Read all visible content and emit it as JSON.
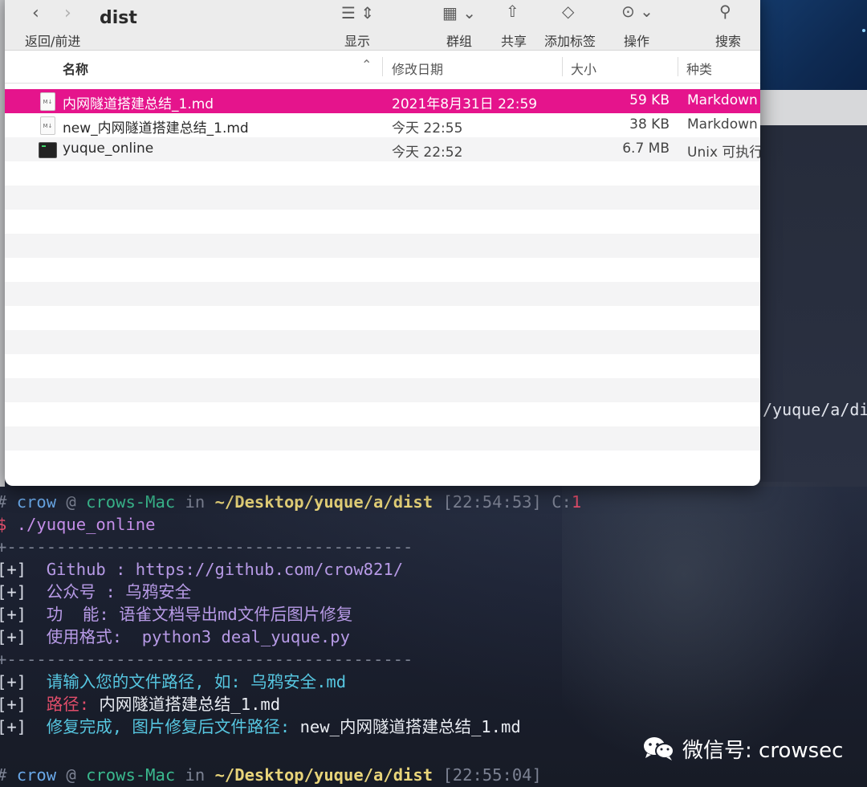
{
  "finder": {
    "title": "dist",
    "nav_label": "返回/前进",
    "toolbar": {
      "view_label": "显示",
      "group_label": "群组",
      "share_label": "共享",
      "tag_label": "添加标签",
      "action_label": "操作",
      "search_label": "搜索"
    },
    "columns": {
      "name": "名称",
      "date": "修改日期",
      "size": "大小",
      "kind": "种类"
    },
    "files": [
      {
        "name": "内网隧道搭建总结_1.md",
        "date": "2021年8月31日 22:59",
        "size": "59 KB",
        "kind": "Markdown",
        "icon": "markdown-file-icon"
      },
      {
        "name": "new_内网隧道搭建总结_1.md",
        "date": "今天 22:55",
        "size": "38 KB",
        "kind": "Markdown",
        "icon": "markdown-file-icon"
      },
      {
        "name": "yuque_online",
        "date": "今天 22:52",
        "size": "6.7 MB",
        "kind": "Unix 可执行",
        "icon": "executable-icon"
      }
    ],
    "selected_color": "#e5148c"
  },
  "side_text": "/yuque/a/di",
  "terminal": {
    "prompt1": {
      "hash": "#",
      "user": "crow",
      "at": "@",
      "host": "crows-Mac",
      "in": "in",
      "path": "~/Desktop/yuque/a/dist",
      "time": "[22:54:53]",
      "code_label": "C:",
      "code": "1"
    },
    "command": {
      "dollar": "$",
      "text": "./yuque_online"
    },
    "separator": "+-----------------------------------------",
    "info_lines": [
      {
        "tag": "[+]",
        "text": "Github : https://github.com/crow821/"
      },
      {
        "tag": "[+]",
        "text": "公众号 : 乌鸦安全"
      },
      {
        "tag": "[+]",
        "text": "功  能: 语雀文档导出md文件后图片修复"
      },
      {
        "tag": "[+]",
        "text": "使用格式:  python3 deal_yuque.py"
      }
    ],
    "prompt_input": {
      "tag": "[+]",
      "text": "请输入您的文件路径, 如: 乌鸦安全.md"
    },
    "path_line": {
      "tag": "[+]",
      "label": "路径: ",
      "value": "内网隧道搭建总结_1.md"
    },
    "done_line": {
      "tag": "[+]",
      "label": "修复完成, 图片修复后文件路径: ",
      "value": "new_内网隧道搭建总结_1.md"
    },
    "prompt2": {
      "hash": "#",
      "user": "crow",
      "at": "@",
      "host": "crows-Mac",
      "in": "in",
      "path": "~/Desktop/yuque/a/dist",
      "time": "[22:55:04]"
    }
  },
  "watermark": {
    "text": "微信号: crowsec",
    "icon": "wechat-icon"
  }
}
